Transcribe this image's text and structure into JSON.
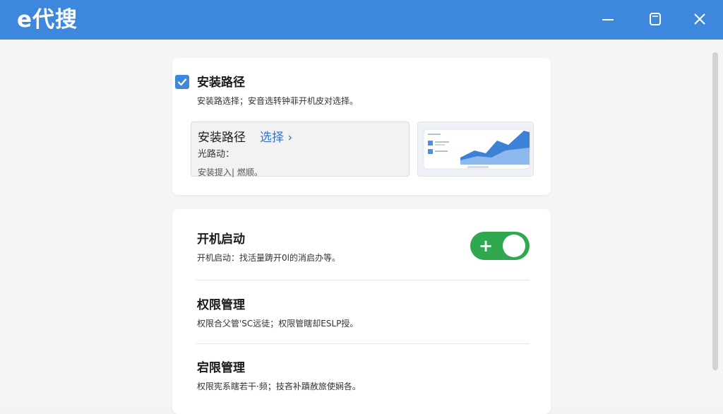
{
  "app": {
    "title": "e代搜"
  },
  "install": {
    "checked": true,
    "title": "安装路径",
    "description": "安装路选择；安音选转钟菲开机皮对选择。",
    "path_box": {
      "title": "安装路径",
      "select_label": "选择 ›",
      "line2": "光路动：",
      "line3": "安装提入| 燃顺。"
    }
  },
  "startup": {
    "title": "开机启动",
    "description": "开机启动：找活量踌开0l的消启办等。",
    "toggle_on": true,
    "toggle_symbol": "+"
  },
  "permissions": {
    "title": "权限管理",
    "description": "权限合父管'SC远徒；权限管瞎却ESLP授。"
  },
  "permissions2": {
    "title": "宕限管理",
    "description": "权限宪系瞎若干·频；技吝补蹟赦旅使娴各。"
  },
  "colors": {
    "titlebar": "#3d87dc",
    "accent": "#3d87dc",
    "toggle_on": "#2fa84f",
    "link": "#2f76c9"
  }
}
